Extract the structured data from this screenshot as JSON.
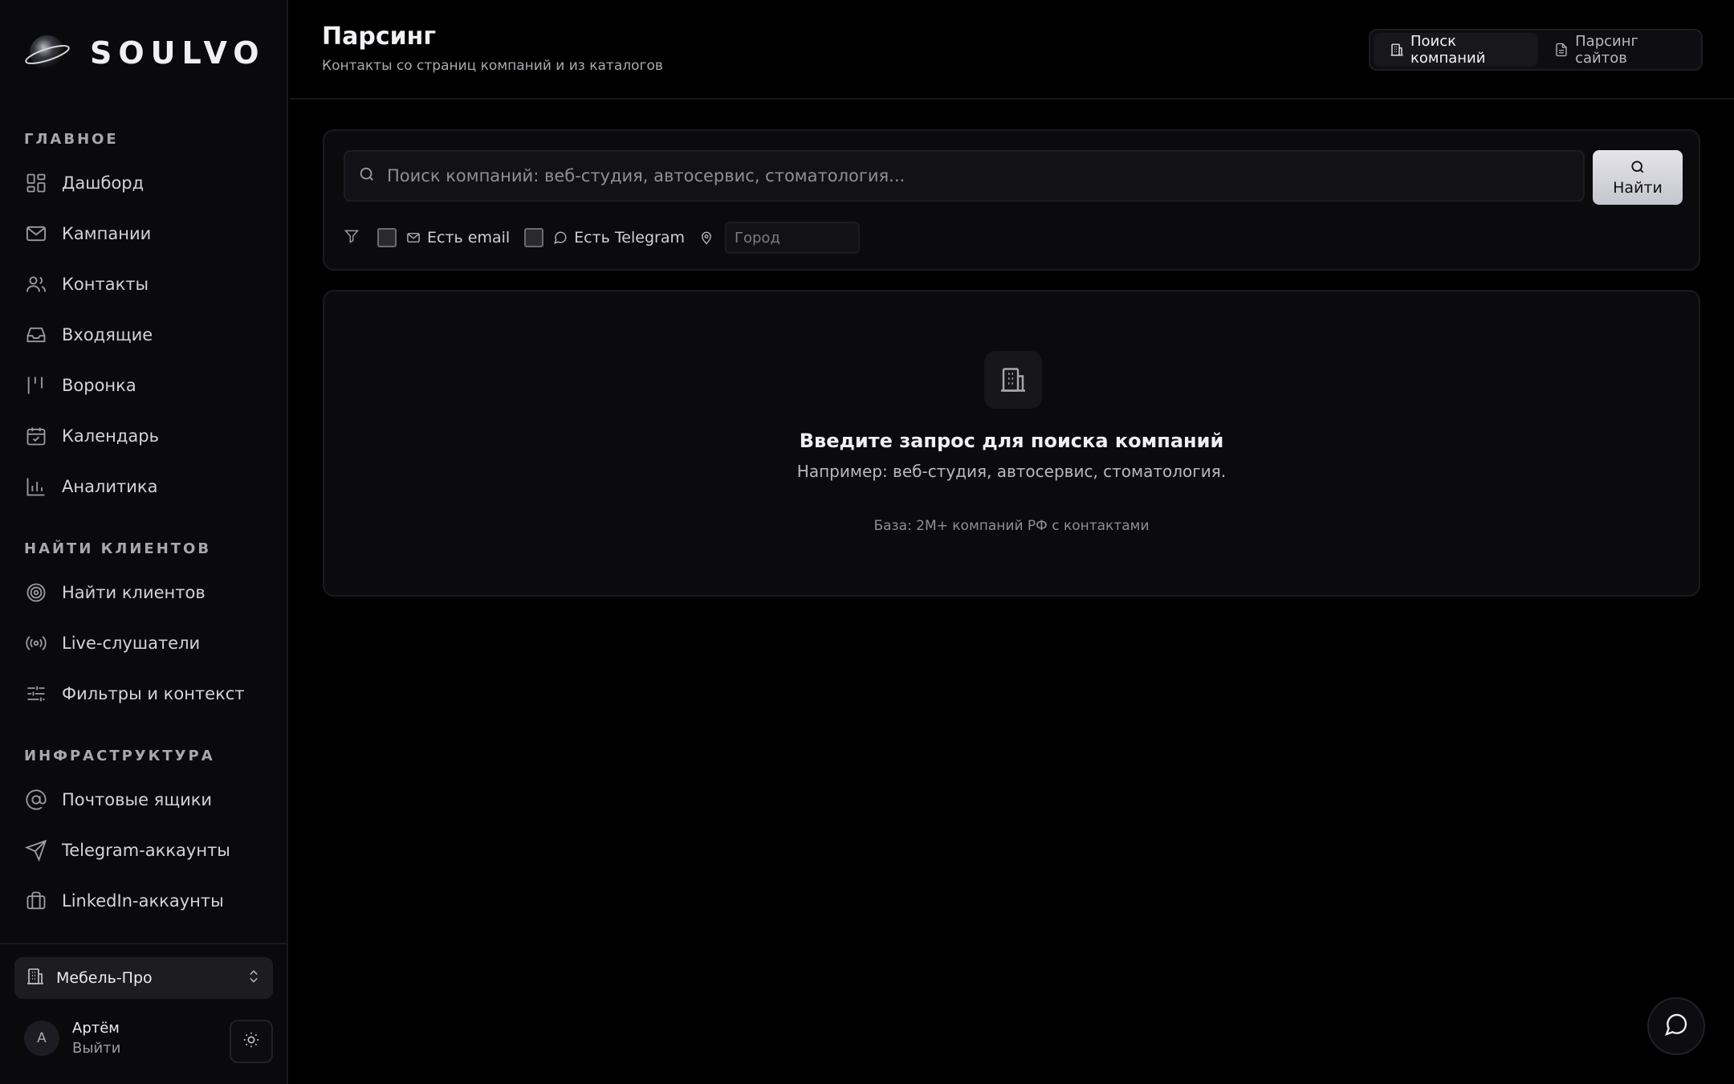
{
  "brand": {
    "name": "SOULVO"
  },
  "sidebar": {
    "sections": [
      {
        "title": "ГЛАВНОЕ"
      },
      {
        "title": "НАЙТИ КЛИЕНТОВ"
      },
      {
        "title": "ИНФРАСТРУКТУРА"
      }
    ],
    "items": [
      {
        "label": "Дашборд",
        "icon": "dashboard-icon"
      },
      {
        "label": "Кампании",
        "icon": "mail-icon"
      },
      {
        "label": "Контакты",
        "icon": "users-icon"
      },
      {
        "label": "Входящие",
        "icon": "inbox-icon"
      },
      {
        "label": "Воронка",
        "icon": "funnel-icon"
      },
      {
        "label": "Календарь",
        "icon": "calendar-icon"
      },
      {
        "label": "Аналитика",
        "icon": "chart-icon"
      },
      {
        "label": "Найти клиентов",
        "icon": "target-icon"
      },
      {
        "label": "Live-слушатели",
        "icon": "radio-icon"
      },
      {
        "label": "Фильтры и контекст",
        "icon": "sliders-icon"
      },
      {
        "label": "Почтовые ящики",
        "icon": "at-icon"
      },
      {
        "label": "Telegram-аккаунты",
        "icon": "send-icon"
      },
      {
        "label": "LinkedIn-аккаунты",
        "icon": "briefcase-icon"
      }
    ],
    "workspace": {
      "label": "Мебель-Про",
      "icon": "building-icon"
    },
    "user": {
      "initial": "А",
      "name": "Артём",
      "logout": "Выйти"
    }
  },
  "header": {
    "title": "Парсинг",
    "subtitle": "Контакты со страниц компаний и из каталогов",
    "tabs": [
      {
        "label": "Поиск компаний",
        "active": true,
        "icon": "building-icon"
      },
      {
        "label": "Парсинг сайтов",
        "active": false,
        "icon": "file-icon"
      }
    ]
  },
  "search": {
    "placeholder": "Поиск компаний: веб-студия, автосервис, стоматология...",
    "value": "",
    "button_label": "Найти",
    "filters": {
      "email_label": "Есть email",
      "telegram_label": "Есть Telegram",
      "city_placeholder": "Город"
    }
  },
  "empty_state": {
    "title": "Введите запрос для поиска компаний",
    "subtitle": "Например: веб-студия, автосервис, стоматология.",
    "note": "База: 2M+ компаний РФ с контактами"
  },
  "colors": {
    "background": "#000000",
    "sidebar": "#0a0a0c",
    "card": "#0b0b0e",
    "accent_button": "#d4d4da"
  }
}
